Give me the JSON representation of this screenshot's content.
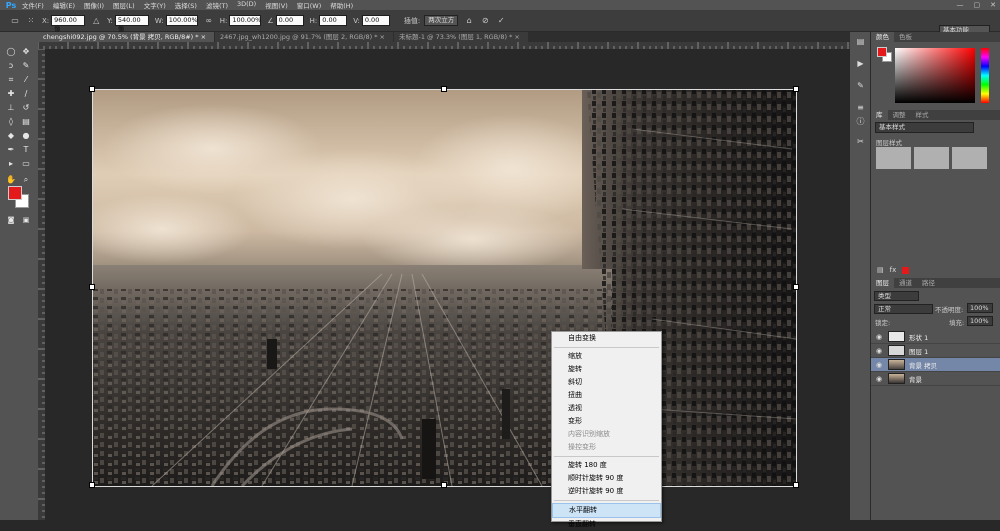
{
  "app": {
    "logo": "Ps"
  },
  "menu": [
    "文件(F)",
    "编辑(E)",
    "图像(I)",
    "图层(L)",
    "文字(Y)",
    "选择(S)",
    "滤镜(T)",
    "3D(D)",
    "视图(V)",
    "窗口(W)",
    "帮助(H)"
  ],
  "options": {
    "x_label": "X:",
    "x_value": "960.00 像",
    "y_label": "Y:",
    "y_value": "540.00 像",
    "w_label": "W:",
    "w_value": "100.00%",
    "h_label": "H:",
    "h_value": "100.00%",
    "angle_value": "0.00",
    "hskew_label": "H:",
    "hskew_value": "0.00",
    "vskew_label": "V:",
    "vskew_value": "0.00",
    "interp_label": "插值:",
    "interp_value": "两次立方",
    "workspace": "基本功能"
  },
  "tabs": [
    {
      "label": "chengshi092.jpg @ 70.5% (背景 拷贝, RGB/8#) *",
      "active": true
    },
    {
      "label": "2467.jpg_wh1200.jpg @ 91.7% (图层 2, RGB/8) *",
      "active": false
    },
    {
      "label": "未标题-1 @ 73.3% (图层 1, RGB/8) *",
      "active": false
    }
  ],
  "context_menu": {
    "items": [
      {
        "label": "自由变换",
        "state": "normal"
      },
      {
        "sep": true
      },
      {
        "label": "缩放",
        "state": "normal"
      },
      {
        "label": "旋转",
        "state": "normal"
      },
      {
        "label": "斜切",
        "state": "normal"
      },
      {
        "label": "扭曲",
        "state": "normal"
      },
      {
        "label": "透视",
        "state": "normal"
      },
      {
        "label": "变形",
        "state": "normal"
      },
      {
        "label": "内容识别缩放",
        "state": "disabled"
      },
      {
        "label": "操控变形",
        "state": "disabled"
      },
      {
        "sep": true
      },
      {
        "label": "旋转 180 度",
        "state": "normal"
      },
      {
        "label": "顺时针旋转 90 度",
        "state": "normal"
      },
      {
        "label": "逆时针旋转 90 度",
        "state": "normal"
      },
      {
        "sep": true
      },
      {
        "label": "水平翻转",
        "state": "highlight"
      },
      {
        "label": "垂直翻转",
        "state": "normal"
      }
    ]
  },
  "panels": {
    "color_tabs": [
      "颜色",
      "色板"
    ],
    "adjust_tabs": [
      "库",
      "调整",
      "样式"
    ],
    "style_select": "基本样式",
    "style_label": "图层样式",
    "layers_tabs": [
      "图层",
      "通道",
      "路径"
    ],
    "filter_kind": "类型",
    "blend_mode": "正常",
    "opacity_label": "不透明度:",
    "opacity_value": "100%",
    "lock_label": "锁定:",
    "fill_label": "填充:",
    "fill_value": "100%",
    "layers": [
      {
        "name": "形状 1",
        "selected": false
      },
      {
        "name": "图层 1",
        "selected": false
      },
      {
        "name": "背景 拷贝",
        "selected": true
      },
      {
        "name": "背景",
        "selected": false
      }
    ]
  },
  "colors": {
    "foreground": "#e3191b",
    "background": "#ffffff",
    "accent": "#31a8ff"
  }
}
